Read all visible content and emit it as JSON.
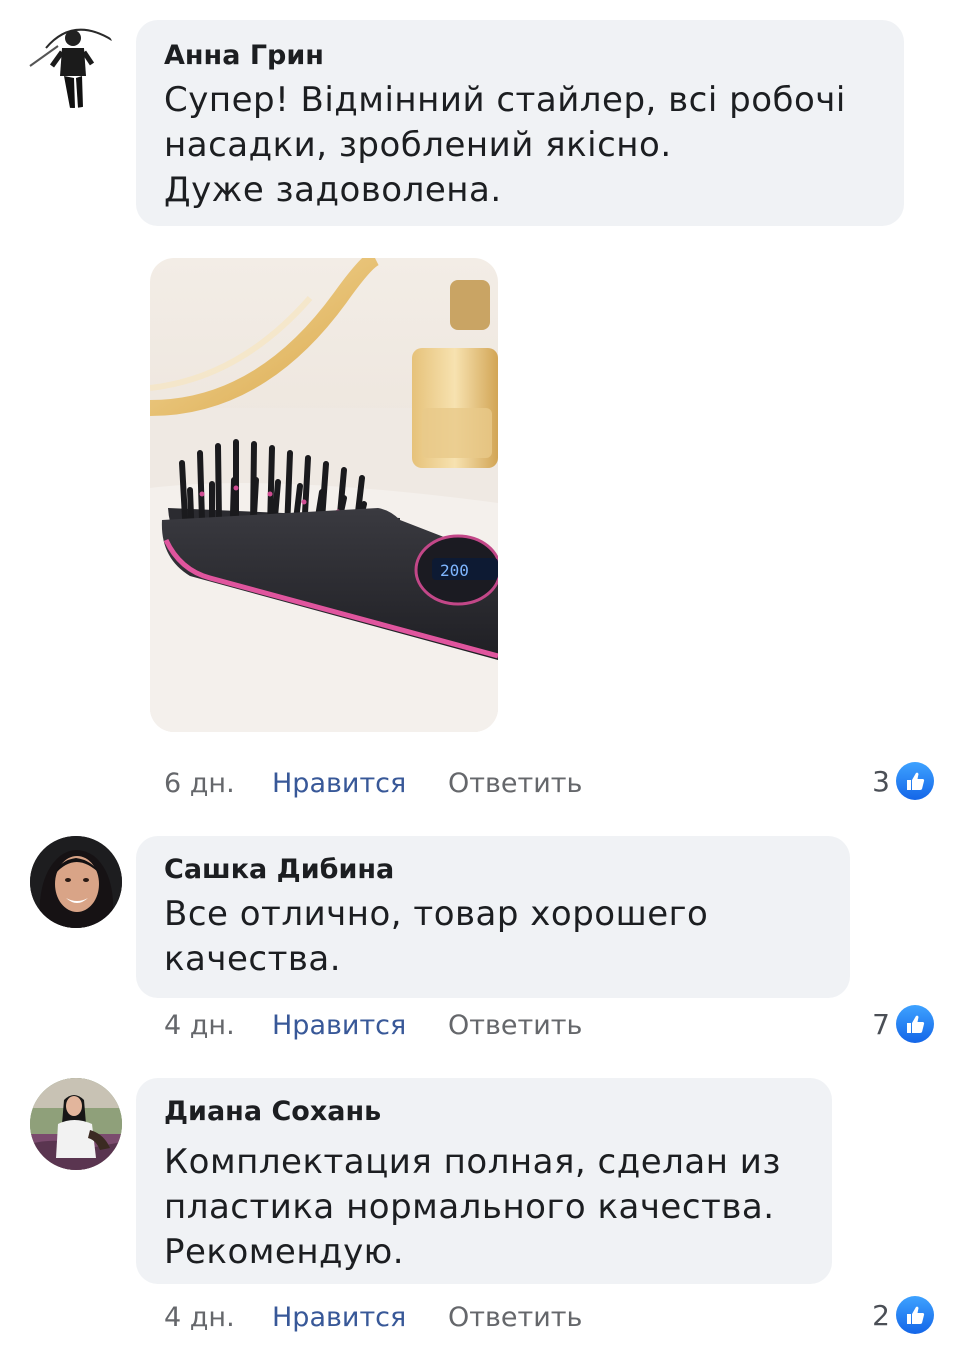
{
  "comments": [
    {
      "author": "Анна Грин",
      "text_lines": [
        "Супер! Відмінний стайлер, всі робочі",
        "насадки, зроблений якісно.",
        "Дуже задоволена."
      ],
      "time": "6 дн.",
      "like_label": "Нравится",
      "reply_label": "Ответить",
      "reaction_count": "3",
      "has_photo": true
    },
    {
      "author": "Сашка Дибина",
      "text_lines": [
        "Все отлично, товар хорошего",
        "качества."
      ],
      "time": "4 дн.",
      "like_label": "Нравится",
      "reply_label": "Ответить",
      "reaction_count": "7"
    },
    {
      "author": "Диана Сохань",
      "text_lines": [
        "Комплектация полная, сделан из",
        "пластика нормального качества.",
        "Рекомендую."
      ],
      "time": "4 дн.",
      "like_label": "Нравится",
      "reply_label": "Ответить",
      "reaction_count": "2"
    }
  ],
  "icons": {
    "reaction": "thumbs-up-icon"
  },
  "colors": {
    "bubble": "#f0f2f5",
    "like_link": "#385898",
    "meta": "#65676b",
    "reaction_blue": "#1877f2"
  }
}
